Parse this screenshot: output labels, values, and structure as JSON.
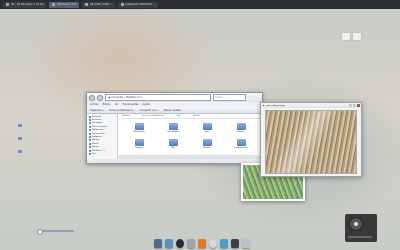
{
  "taskbar": {
    "tasks": [
      {
        "label": "00 - 04 Windows 7 VS 01"
      },
      {
        "label": "Windows 7 Ult"
      },
      {
        "label": "08_0965_0090..."
      },
      {
        "label": "wallpaper 00697021..."
      }
    ],
    "active_index": 1,
    "clock": ""
  },
  "desktop_icons": [
    {
      "name": "icon-1",
      "label": ""
    },
    {
      "name": "icon-2",
      "label": ""
    },
    {
      "name": "icon-3",
      "label": ""
    }
  ],
  "explorer": {
    "address": "Computer ▸ Headline (C:)",
    "search_placeholder": "Search...",
    "menu": [
      "Archivo",
      "Edición",
      "Ver",
      "Herramientas",
      "Ayuda"
    ],
    "commands": [
      "Organizar ▾",
      "Incluir en biblioteca ▾",
      "Compartir con ▾",
      "Nueva carpeta"
    ],
    "columns": [
      "Nombre",
      "Fecha de modificación",
      "Tipo",
      "Tamaño"
    ],
    "nav_items": [
      "Favoritos",
      "Escritorio",
      "Descargas",
      "Sitios recientes",
      "Bibliotecas",
      "Documentos",
      "Imágenes",
      "Música",
      "Vídeos",
      "Equipo",
      "Headline (C:)",
      "Red"
    ],
    "folders": [
      "Documents",
      "Downloads",
      "Files",
      "Games",
      "Images",
      "Misc",
      "Movies",
      "Programmes"
    ]
  },
  "viewer": {
    "title": "trigo_wallpaper.jpg"
  },
  "dock": {
    "items": [
      "finder",
      "firefox",
      "itunes",
      "vlc",
      "chrome",
      "messenger",
      "steam",
      "trash"
    ]
  },
  "colors": {
    "taskbar_bg": "#2a2d30",
    "accent": "#4f7fc0",
    "close_red": "#c9473a"
  }
}
